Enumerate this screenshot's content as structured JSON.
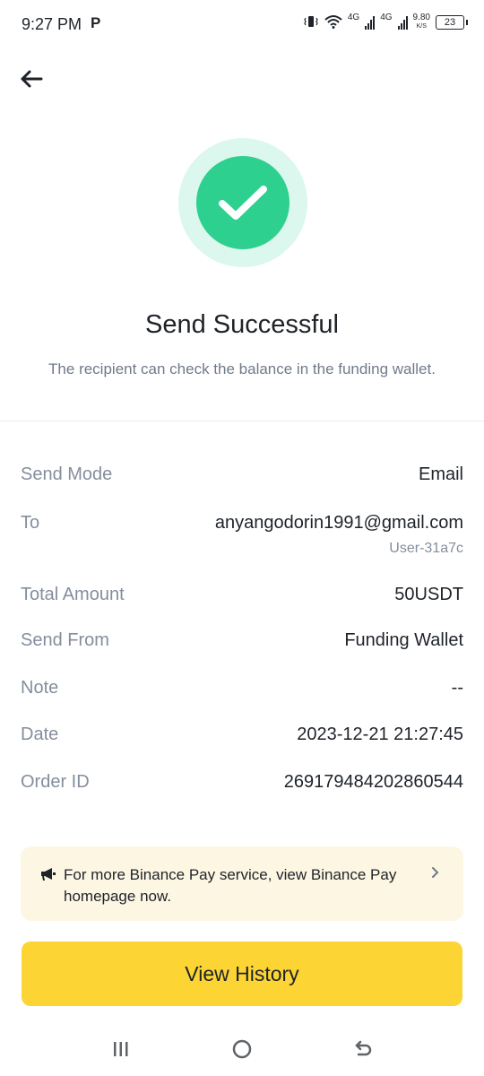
{
  "status_bar": {
    "time": "9:27 PM",
    "p_indicator": "P",
    "net1": "4G",
    "net2": "4G",
    "speed_value": "9.80",
    "speed_unit": "K/S",
    "battery": "23"
  },
  "header": {
    "back_icon": "arrow-left-icon"
  },
  "result": {
    "icon": "check-circle-icon",
    "title": "Send Successful",
    "subtitle": "The recipient can check the balance in the funding wallet."
  },
  "details": {
    "send_mode": {
      "label": "Send Mode",
      "value": "Email"
    },
    "to": {
      "label": "To",
      "value": "anyangodorin1991@gmail.com",
      "sub": "User-31a7c"
    },
    "total_amount": {
      "label": "Total Amount",
      "value": "50USDT"
    },
    "send_from": {
      "label": "Send From",
      "value": "Funding Wallet"
    },
    "note": {
      "label": "Note",
      "value": "--"
    },
    "date": {
      "label": "Date",
      "value": "2023-12-21 21:27:45"
    },
    "order_id": {
      "label": "Order ID",
      "value": "269179484202860544"
    }
  },
  "banner": {
    "icon": "megaphone-icon",
    "text": "For more Binance Pay service, view Binance Pay homepage now.",
    "chevron": "chevron-right-icon"
  },
  "actions": {
    "view_history": "View History"
  },
  "nav": {
    "recents": "recents-icon",
    "home": "home-icon",
    "back": "back-icon"
  },
  "colors": {
    "accent": "#FCD535",
    "success": "#2ED08F",
    "success_halo": "#DCF7EE",
    "banner_bg": "#FDF6E3"
  }
}
